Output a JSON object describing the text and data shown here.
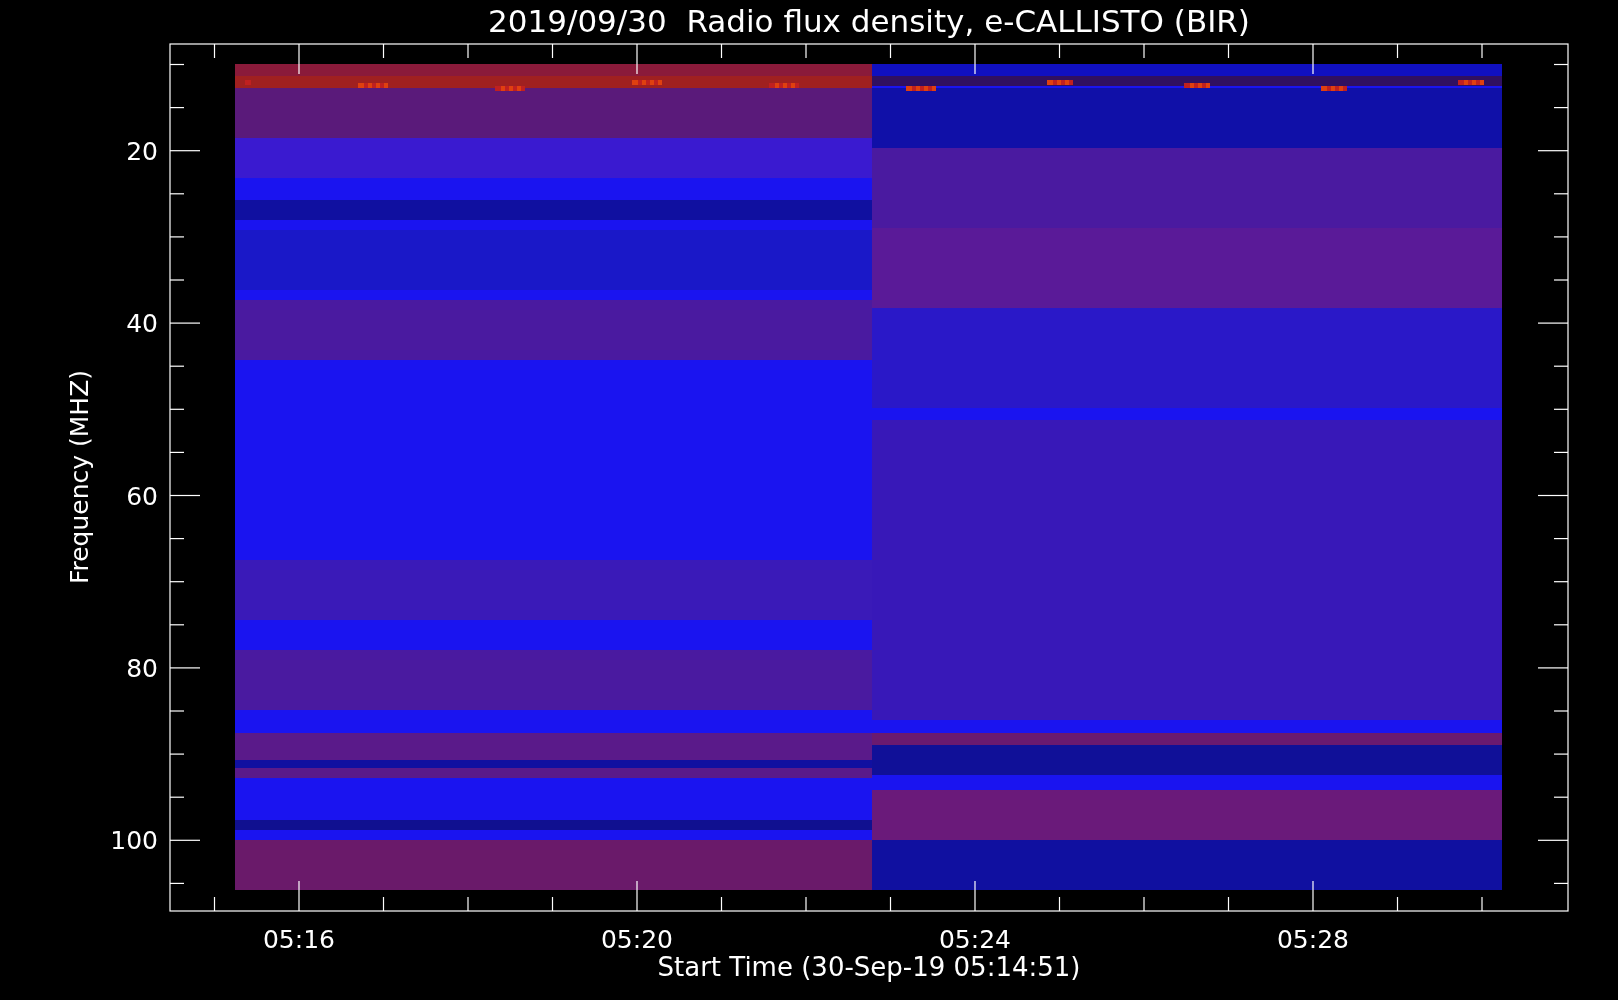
{
  "title": "2019/09/30  Radio flux density, e-CALLISTO (BIR)",
  "y_axis": {
    "label": "Frequency (MHZ)",
    "ticks": [
      "20",
      "40",
      "60",
      "80",
      "100"
    ]
  },
  "x_axis": {
    "label": "Start Time (30-Sep-19 05:14:51)",
    "ticks": [
      "05:16",
      "05:20",
      "05:24",
      "05:28"
    ]
  }
}
